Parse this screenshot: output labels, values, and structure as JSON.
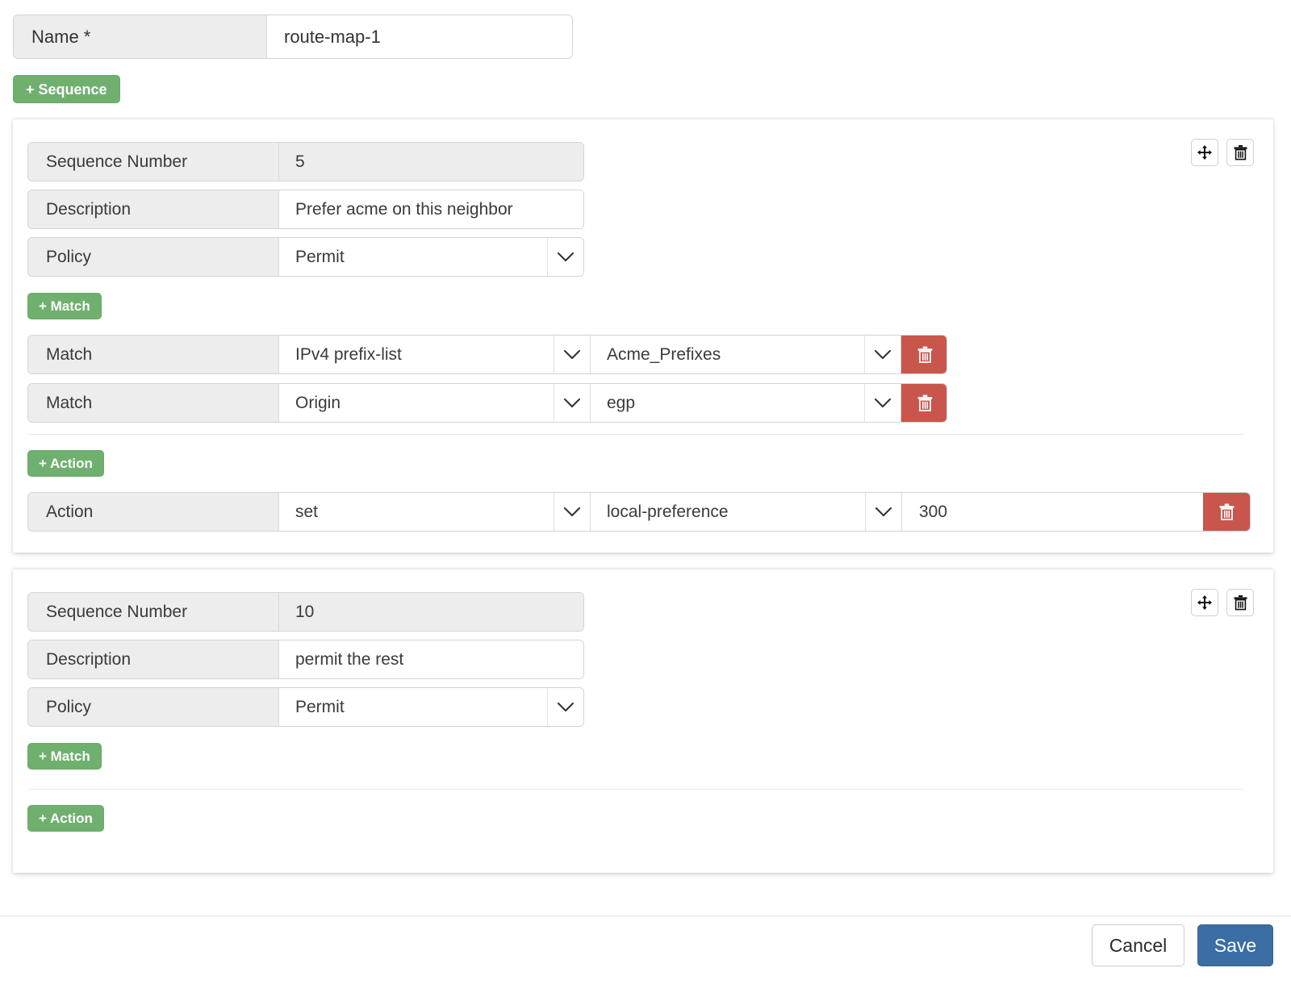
{
  "form": {
    "name_label": "Name *",
    "name_value": "route-map-1",
    "add_sequence_label": "+ Sequence"
  },
  "labels": {
    "sequence_number": "Sequence Number",
    "description": "Description",
    "policy": "Policy",
    "match": "Match",
    "action": "Action",
    "add_match": "+ Match",
    "add_action": "+ Action"
  },
  "icons": {
    "move": "move-icon",
    "trash": "trash-icon",
    "chevron": "chevron-down-icon"
  },
  "colors": {
    "green": "#6fb06f",
    "red": "#c8564c",
    "blue": "#3a6ea5",
    "label_bg": "#ededed"
  },
  "sequences": [
    {
      "sequence_number": "5",
      "description": "Prefer acme on this neighbor",
      "policy": "Permit",
      "matches": [
        {
          "type": "IPv4 prefix-list",
          "value": "Acme_Prefixes"
        },
        {
          "type": "Origin",
          "value": "egp"
        }
      ],
      "actions": [
        {
          "operation": "set",
          "attribute": "local-preference",
          "value": "300"
        }
      ]
    },
    {
      "sequence_number": "10",
      "description": "permit the rest",
      "policy": "Permit",
      "matches": [],
      "actions": []
    }
  ],
  "footer": {
    "cancel_label": "Cancel",
    "save_label": "Save"
  }
}
